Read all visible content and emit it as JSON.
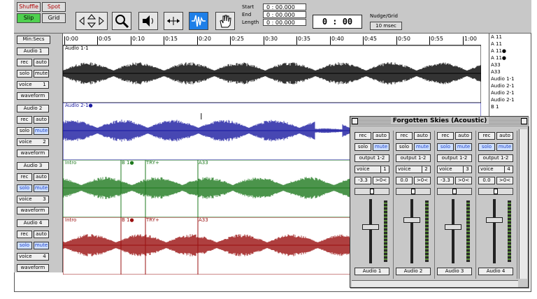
{
  "toolbar": {
    "modes": [
      "Shuffle",
      "Spot",
      "Slip",
      "Grid"
    ],
    "start_label": "Start",
    "end_label": "End",
    "length_label": "Length",
    "start_value": "0 : 00.000",
    "end_value": "0 : 00.000",
    "length_value": "0 : 00.000",
    "counter": "0 : 00",
    "nudge_label": "Nudge/Grid",
    "nudge_value": "10 msec"
  },
  "ruler": {
    "label": "Min:Secs",
    "ticks": [
      "0:00",
      "0:05",
      "0:10",
      "0:15",
      "0:20",
      "0:25",
      "0:30",
      "0:35",
      "0:40",
      "0:45",
      "0:50",
      "0:55",
      "1:00"
    ]
  },
  "regions_list": [
    "A 11",
    "A 11",
    "A 11●",
    "A 11●",
    "A33",
    "A33",
    "Audio 1-1",
    "Audio 2-1",
    "Audio 2-1",
    "Audio 2-1",
    "B 1"
  ],
  "tracks": [
    {
      "name": "Audio 1",
      "voice": "voice",
      "voice_num": "1",
      "rec": "rec",
      "auto": "auto",
      "solo": "solo",
      "mute": "mute",
      "view": "waveform",
      "color": "#000000",
      "regions": [
        "Audio 1-1"
      ]
    },
    {
      "name": "Audio 2",
      "voice": "voice",
      "voice_num": "2",
      "rec": "rec",
      "auto": "auto",
      "solo": "solo",
      "mute": "mute",
      "view": "waveform",
      "color": "#1a1aa0",
      "regions": [
        "Audio 2-1●"
      ]
    },
    {
      "name": "Audio 3",
      "voice": "voice",
      "voice_num": "3",
      "rec": "rec",
      "auto": "auto",
      "solo": "solo",
      "mute": "mute",
      "view": "waveform",
      "color": "#1f7a1f",
      "regions": [
        "Intro",
        "B 1●",
        "TRY+",
        "A33"
      ]
    },
    {
      "name": "Audio 4",
      "voice": "voice",
      "voice_num": "4",
      "rec": "rec",
      "auto": "auto",
      "solo": "solo",
      "mute": "mute",
      "view": "waveform",
      "color": "#9a1010",
      "regions": [
        "Intro",
        "B 1●",
        "TRY+",
        "A33"
      ]
    }
  ],
  "mixer": {
    "title": "Forgotten Skies (Acoustic)",
    "strips": [
      {
        "rec": "rec",
        "auto": "auto",
        "solo": "solo",
        "mute": "mute",
        "output": "output 1-2",
        "voice": "voice",
        "voice_num": "1",
        "vol": "-3.3",
        "pan": ">0<",
        "name": "Audio 1"
      },
      {
        "rec": "rec",
        "auto": "auto",
        "solo": "solo",
        "mute": "mute",
        "output": "output 1-2",
        "voice": "voice",
        "voice_num": "2",
        "vol": "0.0",
        "pan": ">0<",
        "name": "Audio 2"
      },
      {
        "rec": "rec",
        "auto": "auto",
        "solo": "solo",
        "mute": "mute",
        "output": "output 1-2",
        "voice": "voice",
        "voice_num": "3",
        "vol": "-3.3",
        "pan": ">0<",
        "name": "Audio 3"
      },
      {
        "rec": "rec",
        "auto": "auto",
        "solo": "solo",
        "mute": "mute",
        "output": "output 1-2",
        "voice": "voice",
        "voice_num": "4",
        "vol": "0.0",
        "pan": ">0<",
        "name": "Audio 4"
      }
    ]
  }
}
